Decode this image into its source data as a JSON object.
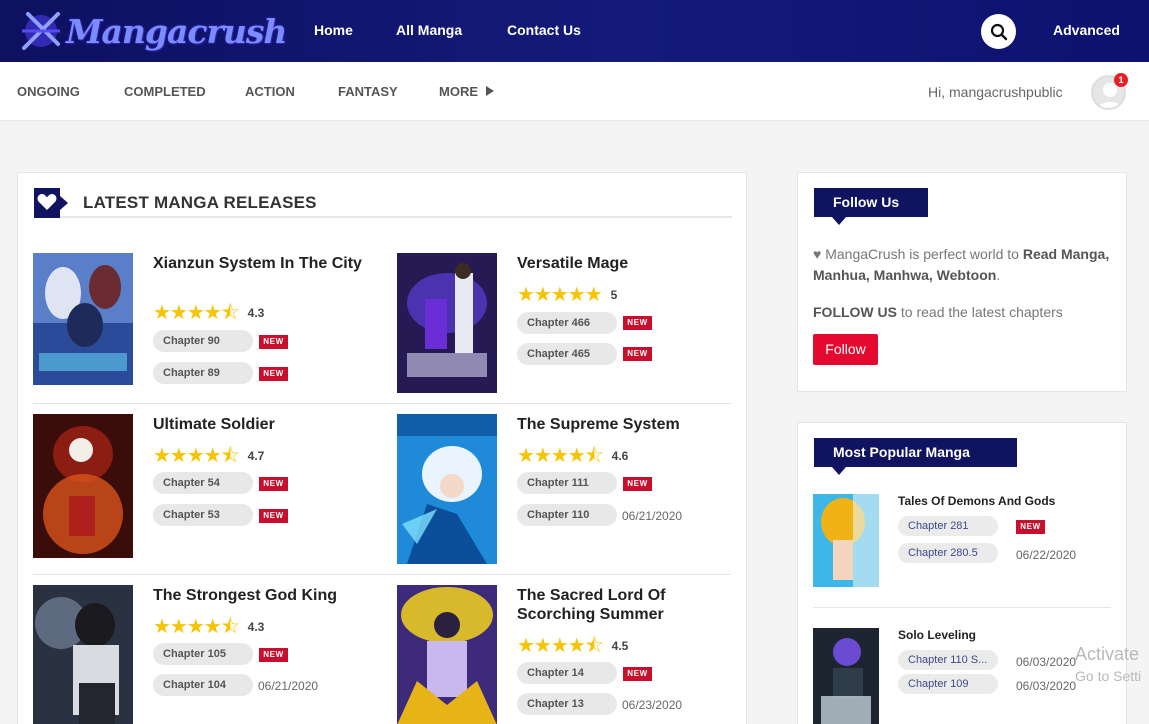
{
  "brand": {
    "name": "Mangacrush"
  },
  "topnav": {
    "home": "Home",
    "all_manga": "All Manga",
    "contact": "Contact Us",
    "advanced": "Advanced"
  },
  "categories": {
    "ongoing": "ONGOING",
    "completed": "COMPLETED",
    "action": "ACTION",
    "fantasy": "FANTASY",
    "more": "MORE"
  },
  "user": {
    "greeting": "Hi, mangacrushpublic",
    "notifications": "1"
  },
  "latest": {
    "heading": "LATEST MANGA RELEASES",
    "items": [
      {
        "title": "Xianzun System In The City",
        "stars": "★★★★⯪",
        "rating": "4.3",
        "chapters": [
          {
            "label": "Chapter 90",
            "tag": "NEW"
          },
          {
            "label": "Chapter 89",
            "tag": "NEW"
          }
        ]
      },
      {
        "title": "Versatile Mage",
        "stars": "★★★★★",
        "rating": "5",
        "chapters": [
          {
            "label": "Chapter 466",
            "tag": "NEW"
          },
          {
            "label": "Chapter 465",
            "tag": "NEW"
          }
        ]
      },
      {
        "title": "Ultimate Soldier",
        "stars": "★★★★⯪",
        "rating": "4.7",
        "chapters": [
          {
            "label": "Chapter 54",
            "tag": "NEW"
          },
          {
            "label": "Chapter 53",
            "tag": "NEW"
          }
        ]
      },
      {
        "title": "The Supreme System",
        "stars": "★★★★⯪",
        "rating": "4.6",
        "chapters": [
          {
            "label": "Chapter 111",
            "tag": "NEW"
          },
          {
            "label": "Chapter 110",
            "date": "06/21/2020"
          }
        ]
      },
      {
        "title": "The Strongest God King",
        "stars": "★★★★⯪",
        "rating": "4.3",
        "chapters": [
          {
            "label": "Chapter 105",
            "tag": "NEW"
          },
          {
            "label": "Chapter 104",
            "date": "06/21/2020"
          }
        ]
      },
      {
        "title": "The Sacred Lord Of Scorching Summer",
        "stars": "★★★★⯪",
        "rating": "4.5",
        "chapters": [
          {
            "label": "Chapter 14",
            "tag": "NEW"
          },
          {
            "label": "Chapter 13",
            "date": "06/23/2020"
          }
        ]
      }
    ]
  },
  "follow": {
    "heading": "Follow Us",
    "heart": "♥",
    "line1_prefix": "MangaCrush is perfect world to",
    "line1_bold": "Read Manga, Manhua, Manhwa, Webtoon",
    "line1_suffix": ".",
    "line2_bold": "FOLLOW US",
    "line2_rest": "to read the latest chapters",
    "button": "Follow"
  },
  "popular": {
    "heading": "Most Popular Manga",
    "items": [
      {
        "title": "Tales Of Demons And Gods",
        "chapters": [
          {
            "label": "Chapter 281",
            "tag": "NEW"
          },
          {
            "label": "Chapter 280.5",
            "date": "06/22/2020"
          }
        ]
      },
      {
        "title": "Solo Leveling",
        "chapters": [
          {
            "label": "Chapter 110 S...",
            "date": "06/03/2020"
          },
          {
            "label": "Chapter 109",
            "date": "06/03/2020"
          }
        ]
      }
    ]
  },
  "watermark": {
    "line1": "Activate",
    "line2": "Go to Setti"
  },
  "colors": {
    "navy": "#10135f",
    "red": "#c8102e",
    "star": "#f6c400",
    "follow": "#e4092e"
  }
}
